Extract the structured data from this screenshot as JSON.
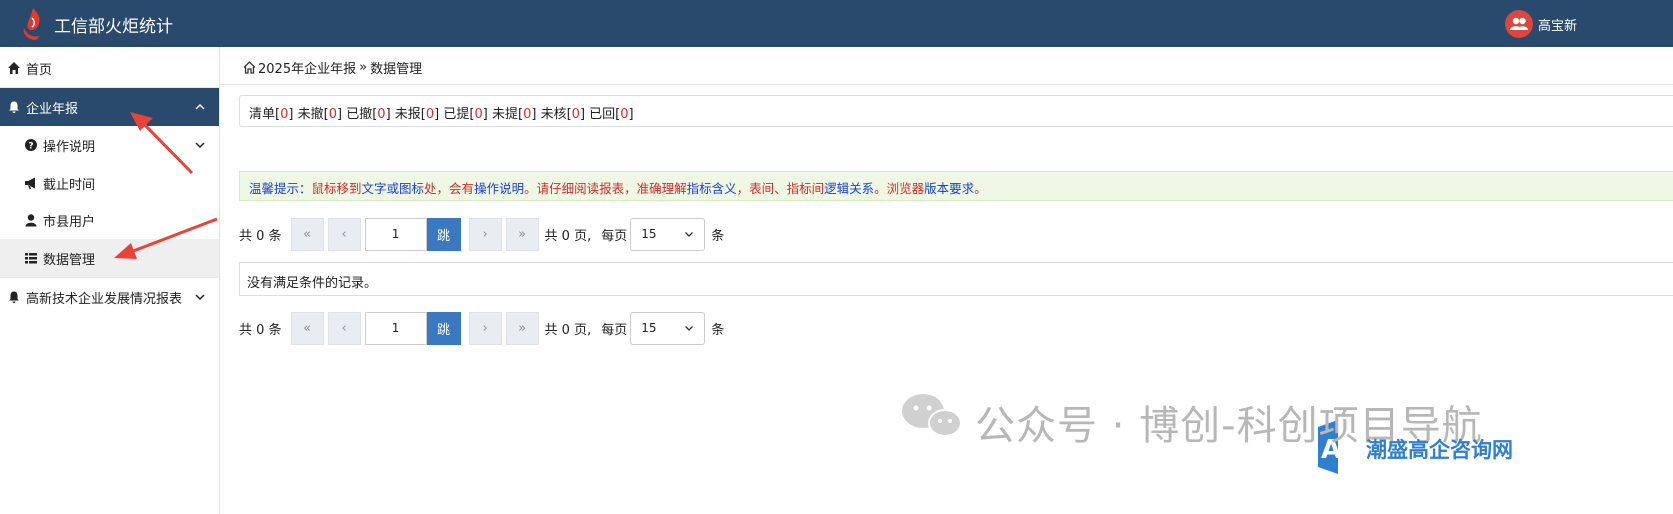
{
  "header": {
    "title": "工信部火炬统计",
    "user_name": "高宝新"
  },
  "sidebar": {
    "home": "首页",
    "annual_report": "企业年报",
    "sub_items": [
      "操作说明",
      "截止时间",
      "市县用户",
      "数据管理"
    ],
    "hightech": "高新技术企业发展情况报表"
  },
  "breadcrumb": {
    "parent": "2025年企业年报",
    "sep": "»",
    "current": "数据管理"
  },
  "status_counts": [
    {
      "label": "清单",
      "count": "0"
    },
    {
      "label": "未撤",
      "count": "0"
    },
    {
      "label": "已撤",
      "count": "0"
    },
    {
      "label": "未报",
      "count": "0"
    },
    {
      "label": "已提",
      "count": "0"
    },
    {
      "label": "未提",
      "count": "0"
    },
    {
      "label": "未核",
      "count": "0"
    },
    {
      "label": "已回",
      "count": "0"
    }
  ],
  "tip": {
    "prefix": "温馨提示：",
    "p1": "鼠标移到",
    "p2": "文字或图标",
    "p3": "处，会有",
    "p4": "操作说明",
    "p5": "。请仔细阅读报表，准确理解",
    "p6": "指标含义",
    "p7": "，表间、指标间",
    "p8": "逻辑关系",
    "p9": "。",
    "p10": "浏览器",
    "p11": "版本要求",
    "p12": "。"
  },
  "pager": {
    "total_label": "共 0 条",
    "page_input": "1",
    "go_label": "跳",
    "pages_label": "共 0 页,",
    "per_page_label": "每页",
    "per_page_value": "15",
    "unit_label": "条"
  },
  "empty_message": "没有满足条件的记录。",
  "watermark": {
    "text": "公众号 · 博创-科创项目导航",
    "brand": "潮盛高企咨询网"
  },
  "colors": {
    "header_bg": "#294a6d",
    "active_bg": "#294a6d",
    "count_red": "#d42b2b",
    "tip_bg": "#eef8e4",
    "go_btn": "#3a78c1"
  }
}
